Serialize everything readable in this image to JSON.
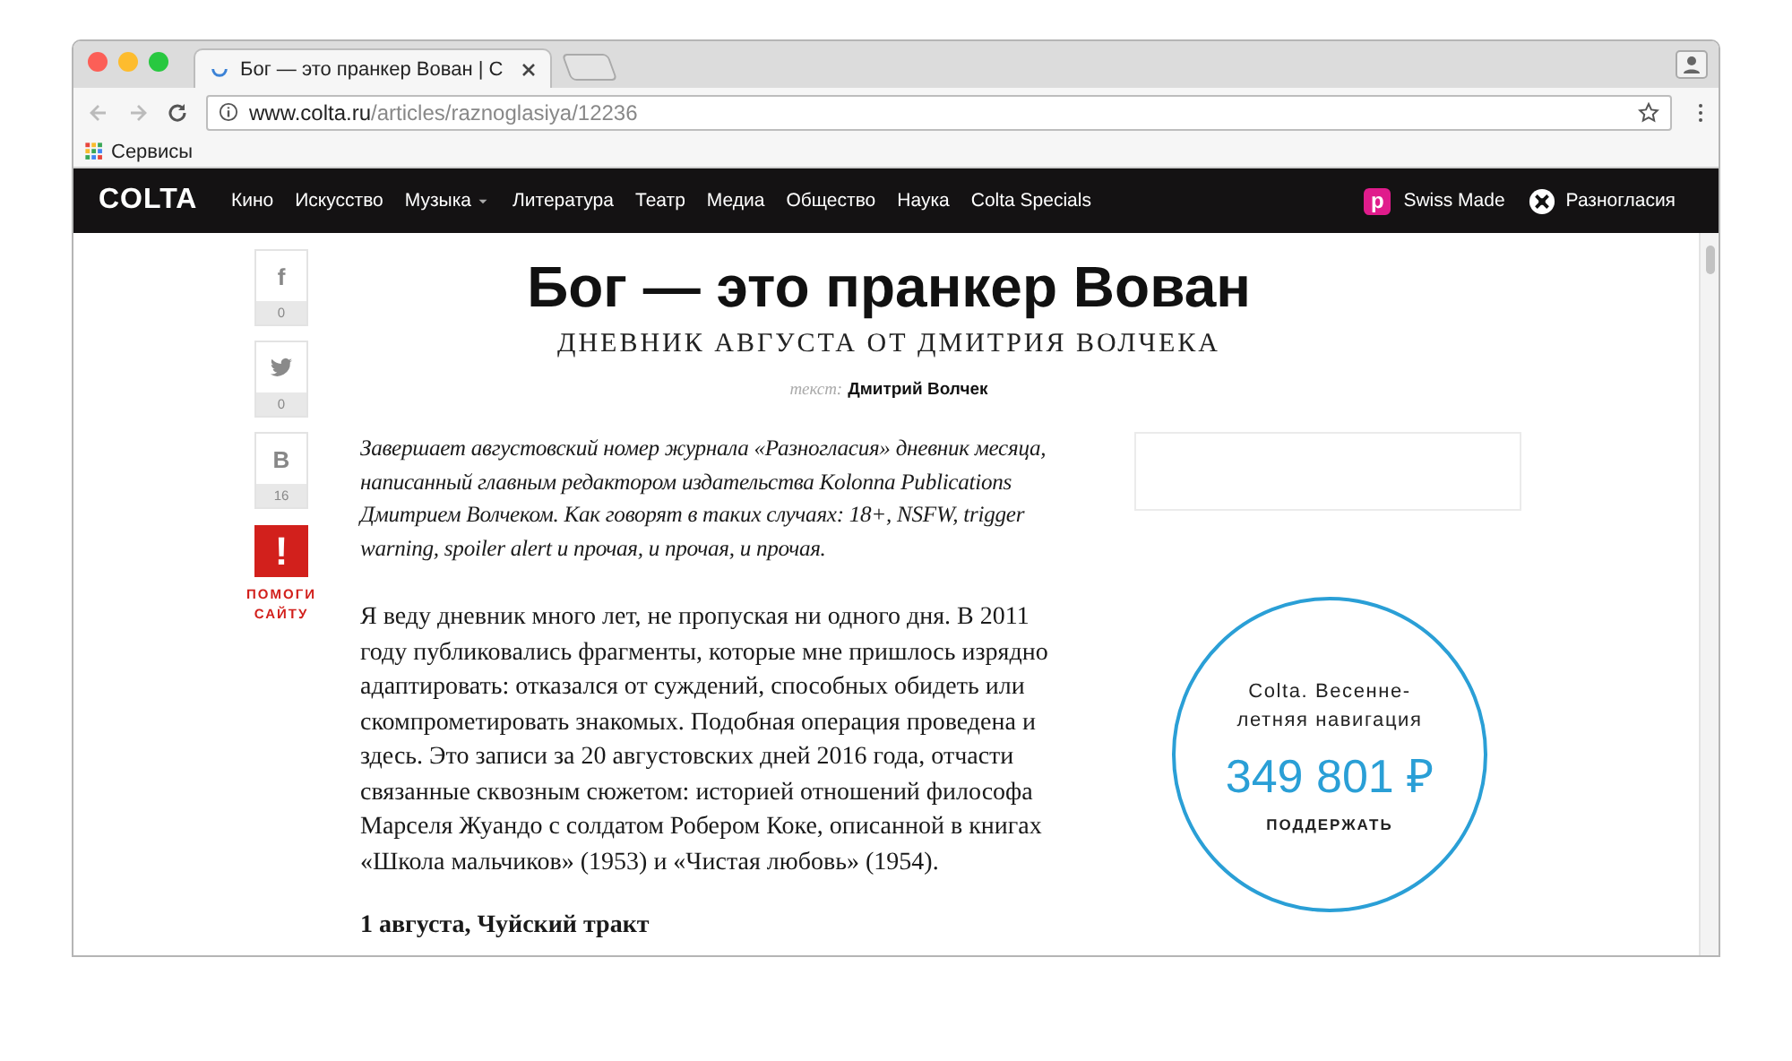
{
  "browser": {
    "tab": {
      "title": "Бог — это пранкер Вован | С"
    },
    "address": {
      "domain": "www.colta.ru",
      "path": "/articles/raznoglasiya/12236"
    },
    "bookmarks": [
      {
        "label": "Сервисы"
      }
    ]
  },
  "nav": {
    "logo": "COLTA",
    "items": [
      {
        "label": "Кино",
        "dropdown": false
      },
      {
        "label": "Искусство",
        "dropdown": false
      },
      {
        "label": "Музыка",
        "dropdown": true
      },
      {
        "label": "Литература",
        "dropdown": false
      },
      {
        "label": "Театр",
        "dropdown": false
      },
      {
        "label": "Медиа",
        "dropdown": false
      },
      {
        "label": "Общество",
        "dropdown": false
      },
      {
        "label": "Наука",
        "dropdown": false
      },
      {
        "label": "Colta Specials",
        "dropdown": false
      }
    ],
    "projects": [
      {
        "kind": "letter",
        "badge": "p",
        "label": "Swiss Made"
      },
      {
        "kind": "cross",
        "label": "Разногласия"
      }
    ]
  },
  "share": [
    {
      "kind": "facebook",
      "glyph": "f",
      "count": "0"
    },
    {
      "kind": "twitter",
      "count": "0"
    },
    {
      "kind": "vk",
      "glyph": "В",
      "count": "16"
    }
  ],
  "donate": {
    "mark": "!",
    "label": "ПОМОГИ САЙТУ"
  },
  "article": {
    "title": "Бог — это пранкер Вован",
    "subtitle": "ДНЕВНИК АВГУСТА ОТ ДМИТРИЯ ВОЛЧЕКА",
    "byline": {
      "label": "текст:",
      "author": "Дмитрий Волчек"
    },
    "lead": "Завершает августовский номер журнала «Разногласия» дневник месяца, написанный главным редактором издательства Kolonna Publications Дмитрием Волчеком. Как говорят в таких случаях: 18+, NSFW, trigger warning, spoiler alert и прочая, и прочая, и прочая.",
    "paragraphs": [
      "Я веду дневник много лет, не пропуская ни одного дня. В 2011 году публиковались фрагменты, которые мне пришлось изрядно адаптировать: отказался от суждений, способных обидеть или скомпрометировать знакомых. Подобная операция проведена и здесь. Это записи за 20 августовских дней 2016 года, отчасти связанные сквозным сюжетом: историей отношений философа Марселя Жуандо с солдатом Робером Коке, описанной в книгах «Школа мальчиков» (1953) и «Чистая любовь» (1954)."
    ],
    "heading": "1 августа, Чуйский тракт"
  },
  "widget": {
    "title": "Colta. Весенне-летняя навигация",
    "amount": "349 801 ₽",
    "action": "ПОДДЕРЖАТЬ"
  }
}
